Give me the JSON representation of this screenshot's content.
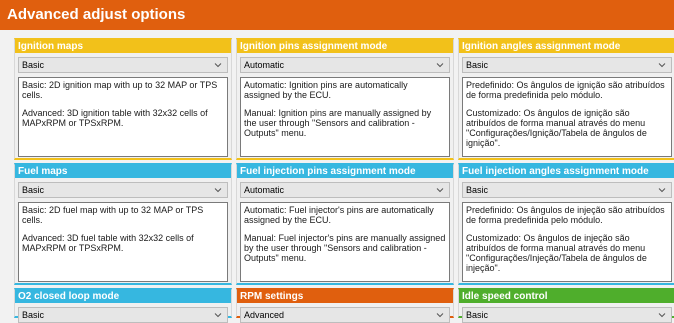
{
  "title": "Advanced adjust options",
  "colors": {
    "title_bar": "#e05f0e",
    "yellow": "#f2c11a",
    "blue": "#36b7e0",
    "orange": "#e05f0e",
    "green": "#4fae2c"
  },
  "panels": [
    {
      "header": "Ignition maps",
      "color": "yellow",
      "value": "Basic",
      "desc": [
        "Basic: 2D ignition map with up to 32 MAP or TPS cells.",
        "Advanced: 3D ignition table with 32x32 cells of MAPxRPM or TPSxRPM."
      ]
    },
    {
      "header": "Ignition pins assignment mode",
      "color": "yellow",
      "value": "Automatic",
      "desc": [
        "Automatic: Ignition pins are automatically assigned by the ECU.",
        "Manual: Ignition pins are manually assigned by the user through \"Sensors and calibration - Outputs\" menu."
      ]
    },
    {
      "header": "Ignition angles assignment mode",
      "color": "yellow",
      "value": "Basic",
      "desc": [
        "Predefinido: Os ângulos de ignição são atribuídos de forma predefinida pelo módulo.",
        "Customizado: Os ângulos de ignição são atribuídos de forma manual através do menu \"Configurações/Ignição/Tabela de ângulos de ignição\"."
      ]
    },
    {
      "header": "Fuel maps",
      "color": "blue",
      "value": "Basic",
      "desc": [
        "Basic: 2D fuel map with up to 32 MAP or TPS cells.",
        "Advanced: 3D fuel table with 32x32 cells of MAPxRPM or TPSxRPM."
      ]
    },
    {
      "header": "Fuel injection pins assignment mode",
      "color": "blue",
      "value": "Automatic",
      "desc": [
        "Automatic: Fuel injector's pins are automatically assigned by the ECU.",
        "Manual: Fuel injector's pins are manually assigned by the user through \"Sensors and calibration - Outputs\" menu."
      ]
    },
    {
      "header": "Fuel injection angles assignment mode",
      "color": "blue",
      "value": "Basic",
      "desc": [
        "Predefinido: Os ângulos de injeção são atribuídos de forma predefinida pelo módulo.",
        "Customizado: Os ângulos de injeção são atribuídos de forma manual através do menu \"Configurações/Injeção/Tabela de ângulos de injeção\"."
      ]
    },
    {
      "header": "O2 closed loop mode",
      "color": "blue",
      "value": "Basic",
      "desc": []
    },
    {
      "header": "RPM settings",
      "color": "orange",
      "value": "Advanced",
      "desc": []
    },
    {
      "header": "Idle speed control",
      "color": "green",
      "value": "Basic",
      "desc": []
    }
  ]
}
